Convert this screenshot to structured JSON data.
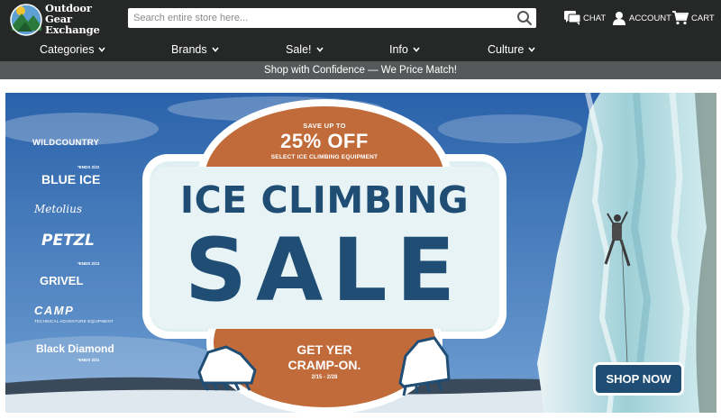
{
  "header": {
    "logo": {
      "line1": "Outdoor",
      "line2": "Gear",
      "line3": "Exchange"
    },
    "search": {
      "placeholder": "Search entire store here...",
      "value": ""
    },
    "utility": {
      "chat": "CHAT",
      "account": "ACCOUNT",
      "cart": "CART"
    }
  },
  "nav": {
    "items": [
      {
        "label": "Categories"
      },
      {
        "label": "Brands"
      },
      {
        "label": "Sale!"
      },
      {
        "label": "Info"
      },
      {
        "label": "Culture"
      }
    ]
  },
  "promo": {
    "text": "Shop with Confidence — We Price Match!"
  },
  "banner": {
    "save_up_to": "SAVE UP TO",
    "percent": "25% OFF",
    "select": "SELECT ICE CLIMBING EQUIPMENT",
    "headline": "ICE CLIMBING",
    "sale": "SALE",
    "tagline_1": "GET YER",
    "tagline_2": "CRAMP-ON.",
    "dates": "2/15 - 2/28",
    "cta": "SHOP NOW",
    "brands": {
      "wild_country": "WILDCOUNTRY",
      "wild_country_ends": "*ENDS 2/22",
      "blue_ice": "BLUE ICE",
      "metolius": "Metolius",
      "petzl": "PETZL",
      "petzl_ends": "*ENDS 2/23",
      "grivel": "GRIVEL",
      "camp": "CAMP",
      "camp_sub": "TECHNICAL ADVENTURE EQUIPMENT",
      "black_diamond": "Black Diamond",
      "black_diamond_ends": "*ENDS 2/21"
    }
  },
  "colors": {
    "header_bg": "#262827",
    "promo_bg": "#55595a",
    "banner_navy": "#1f4d74",
    "banner_orange": "#c16b3a",
    "sky_blue": "#2f6bb2"
  },
  "icons": {
    "logo": "mountain-logo-icon",
    "search": "search-icon",
    "chat": "chat-icon",
    "account": "user-icon",
    "cart": "cart-icon",
    "chevron": "chevron-down-icon"
  }
}
